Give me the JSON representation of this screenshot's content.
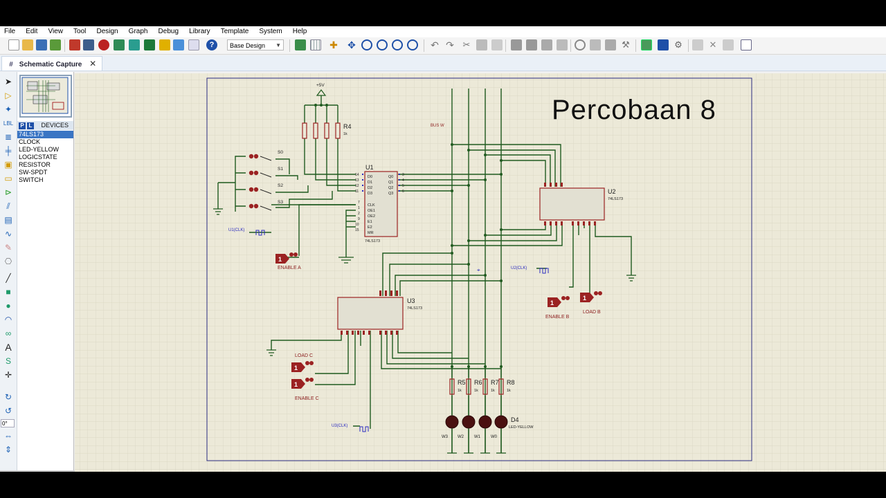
{
  "menu": [
    "File",
    "Edit",
    "View",
    "Tool",
    "Design",
    "Graph",
    "Debug",
    "Library",
    "Template",
    "System",
    "Help"
  ],
  "toolbar": {
    "design_select": "Base Design"
  },
  "tab": {
    "label": "Schematic Capture",
    "close": "✕"
  },
  "device_panel": {
    "badges": [
      "P",
      "L"
    ],
    "title": "DEVICES",
    "items": [
      "74LS173",
      "CLOCK",
      "LED-YELLOW",
      "LOGICSTATE",
      "RESISTOR",
      "SW-SPDT",
      "SWITCH"
    ],
    "selected": "74LS173"
  },
  "left_tool_readout": "0°",
  "overlay_title": "Percobaan 8",
  "schematic": {
    "supply": "+5V",
    "bus": "BUS W",
    "resistor_top": "R4",
    "resistor_value": "1k",
    "switches": [
      "S0",
      "S1",
      "S2",
      "S3"
    ],
    "chips": [
      {
        "ref": "U1",
        "part": "74LS173"
      },
      {
        "ref": "U2",
        "part": "74LS173"
      },
      {
        "ref": "U3",
        "part": "74LS173"
      }
    ],
    "u1_pins_left": [
      "D0",
      "D1",
      "D2",
      "D3",
      "CLK",
      "OE1",
      "OE2",
      "E1",
      "E2",
      "MR"
    ],
    "u1_pins_right": [
      "Q0",
      "Q1",
      "Q2",
      "Q3"
    ],
    "u1_pin_numbers_left": [
      "14",
      "13",
      "12",
      "11",
      "7",
      "1",
      "2",
      "9",
      "10",
      "15"
    ],
    "u1_pin_numbers_right": [
      "3",
      "4",
      "5",
      "6"
    ],
    "clocks": [
      "U1(CLK)",
      "U2(CLK)",
      "U3(CLK)"
    ],
    "logicstates": [
      {
        "value": "1",
        "label": "ENABLE A"
      },
      {
        "value": "1",
        "label": "ENABLE B"
      },
      {
        "value": "1",
        "label": "LOAD B"
      },
      {
        "value": "1",
        "label": "LOAD C"
      },
      {
        "value": "1",
        "label": "ENABLE C"
      }
    ],
    "resistors_bottom": [
      "R5",
      "R6",
      "R7",
      "R8"
    ],
    "led": "D4",
    "led_part": "LED-YELLOW",
    "led_labels": [
      "W3",
      "W2",
      "W1",
      "W0"
    ]
  },
  "colors": {
    "sheet_bg": "#ece9d8",
    "grid": "#d6d3c0",
    "wire": "#1f5a1f",
    "component": "#9b2222",
    "chip_fill": "#e2e0d2",
    "text_dark": "#202020",
    "label_red": "#8a1c1c",
    "net_blue": "#2a2ac0"
  }
}
